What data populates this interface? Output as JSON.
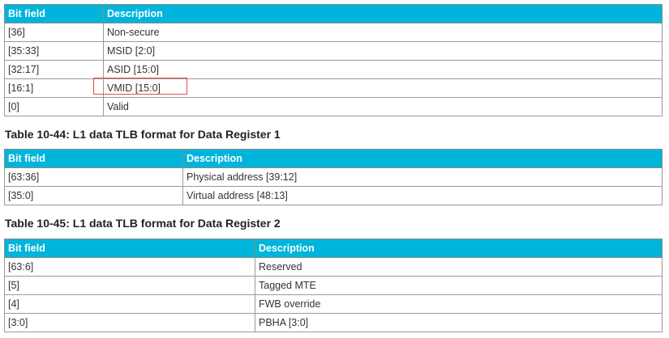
{
  "table1": {
    "headers": [
      "Bit field",
      "Description"
    ],
    "rows": [
      [
        "[36]",
        "Non-secure"
      ],
      [
        "[35:33]",
        "MSID [2:0]"
      ],
      [
        "[32:17]",
        "ASID [15:0]"
      ],
      [
        "[16:1]",
        "VMID [15:0]"
      ],
      [
        "[0]",
        "Valid"
      ]
    ],
    "highlighted_cell": "VMID [15:0]"
  },
  "table2": {
    "caption": "Table 10-44: L1 data TLB format for Data Register 1",
    "headers": [
      "Bit field",
      "Description"
    ],
    "rows": [
      [
        "[63:36]",
        "Physical address [39:12]"
      ],
      [
        "[35:0]",
        "Virtual address [48:13]"
      ]
    ]
  },
  "table3": {
    "caption": "Table 10-45: L1 data TLB format for Data Register 2",
    "headers": [
      "Bit field",
      "Description"
    ],
    "rows": [
      [
        "[63:6]",
        "Reserved"
      ],
      [
        "[5]",
        "Tagged MTE"
      ],
      [
        "[4]",
        "FWB override"
      ],
      [
        "[3:0]",
        "PBHA [3:0]"
      ]
    ]
  },
  "colors": {
    "header_bg": "#00b5dc",
    "header_text": "#ffffff",
    "highlight_border": "#d9534f"
  }
}
